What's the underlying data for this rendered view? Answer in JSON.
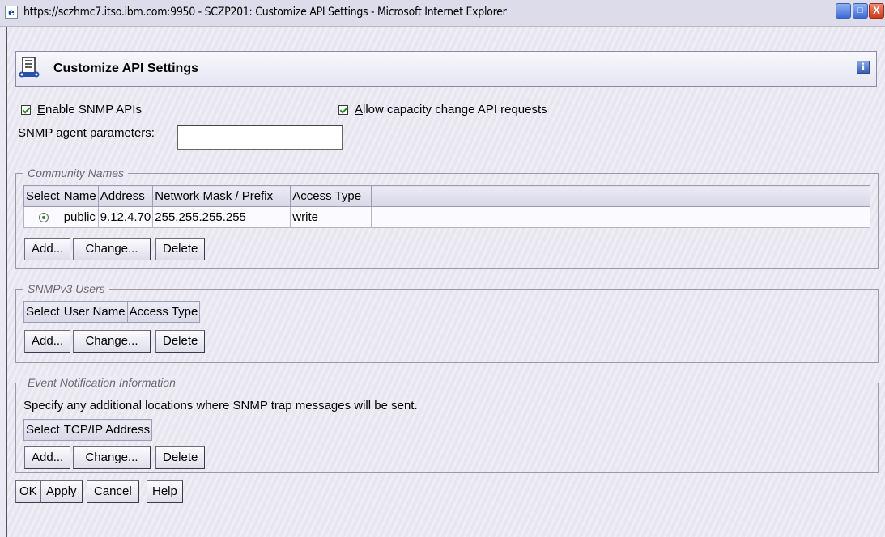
{
  "window": {
    "title": "https://sczhmc7.itso.ibm.com:9950 - SCZP201: Customize API Settings - Microsoft Internet Explorer",
    "controls": {
      "minimize": "_",
      "maximize": "□",
      "close": "X"
    }
  },
  "header": {
    "title": "Customize API Settings",
    "info_icon_glyph": "i"
  },
  "options": {
    "enable_snmp": {
      "label_first": "E",
      "label_rest": "nable SNMP APIs",
      "checked": true
    },
    "allow_capacity": {
      "label_first": "A",
      "label_rest": "llow capacity change API requests",
      "checked": true
    },
    "snmp_agent_label": "SNMP agent parameters:",
    "snmp_agent_value": ""
  },
  "community_names": {
    "legend": "Community Names",
    "columns": [
      "Select",
      "Name",
      "Address",
      "Network Mask / Prefix",
      "Access Type"
    ],
    "rows": [
      {
        "selected": true,
        "name": "public",
        "address": "9.12.4.70",
        "mask": "255.255.255.255",
        "access": "write"
      }
    ],
    "buttons": {
      "add": "Add...",
      "change": "Change...",
      "delete": "Delete"
    }
  },
  "snmpv3_users": {
    "legend": "SNMPv3 Users",
    "columns": [
      "Select",
      "User Name",
      "Access Type"
    ],
    "buttons": {
      "add": "Add...",
      "change": "Change...",
      "delete": "Delete"
    }
  },
  "event_notification": {
    "legend": "Event Notification Information",
    "description": "Specify any additional locations where SNMP trap messages will be sent.",
    "columns": [
      "Select",
      "TCP/IP Address"
    ],
    "buttons": {
      "add": "Add...",
      "change": "Change...",
      "delete": "Delete"
    }
  },
  "footer": {
    "ok": "OK",
    "apply": "Apply",
    "cancel": "Cancel",
    "help": "Help"
  }
}
